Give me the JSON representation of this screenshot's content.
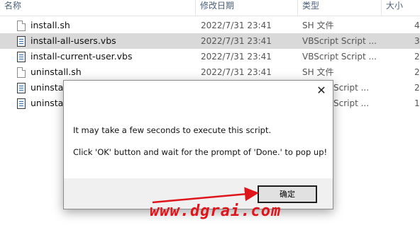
{
  "header": {
    "col_name": "名称",
    "col_date": "修改日期",
    "col_type": "类型",
    "col_size": "大小"
  },
  "files": [
    {
      "name": "install.sh",
      "date": "2022/7/31 23:41",
      "type": "SH 文件",
      "size": "4",
      "icon": "sh-file-icon",
      "selected": false
    },
    {
      "name": "install-all-users.vbs",
      "date": "2022/7/31 23:41",
      "type": "VBScript Script ...",
      "size": "3",
      "icon": "vbs-file-icon",
      "selected": true
    },
    {
      "name": "install-current-user.vbs",
      "date": "2022/7/31 23:41",
      "type": "VBScript Script ...",
      "size": "2",
      "icon": "vbs-file-icon",
      "selected": false
    },
    {
      "name": "uninstall.sh",
      "date": "2022/7/31 23:41",
      "type": "SH 文件",
      "size": "2",
      "icon": "sh-file-icon",
      "selected": false
    },
    {
      "name": "uninstall",
      "date": "",
      "type": "Script ...",
      "size": "2",
      "icon": "vbs-file-icon",
      "selected": false
    },
    {
      "name": "uninstall",
      "date": "",
      "type": "Script ...",
      "size": "1",
      "icon": "vbs-file-icon",
      "selected": false
    }
  ],
  "dialog": {
    "close_glyph": "✕",
    "message_line1": "It may take a few seconds to execute this script.",
    "message_line2": "Click 'OK' button and wait for the prompt of 'Done.' to pop up!",
    "ok_label": "确定"
  },
  "watermark": "www.dgrai.com",
  "colors": {
    "selected_row": "#d9d9d9",
    "annotation_red": "#e0141b"
  }
}
